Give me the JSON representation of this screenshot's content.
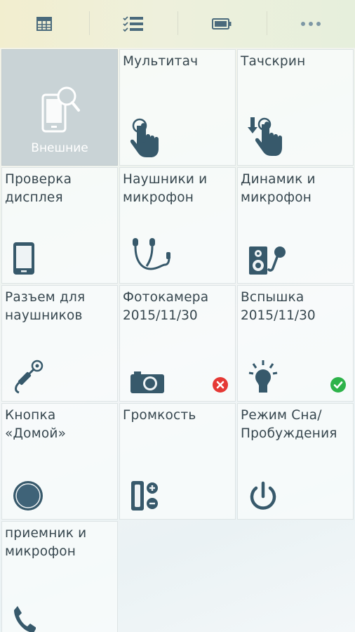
{
  "toolbar": {
    "tabs": [
      {
        "icon": "table-icon"
      },
      {
        "icon": "checklist-icon"
      },
      {
        "icon": "battery-icon"
      },
      {
        "icon": "more-icon"
      }
    ]
  },
  "colors": {
    "icon": "#37596b",
    "text": "#37474f",
    "error": "#e53935",
    "success": "#2eb34a",
    "active_tile": "#c9d3d6"
  },
  "tiles": [
    {
      "label": "Внешние",
      "icon": "phone-search-icon",
      "active": true
    },
    {
      "label": "Мультитач",
      "icon": "multitouch-icon"
    },
    {
      "label": "Тачскрин",
      "icon": "touchscreen-icon"
    },
    {
      "label": "Проверка дисплея",
      "icon": "display-icon"
    },
    {
      "label": "Наушники и микрофон",
      "icon": "headset-icon"
    },
    {
      "label": "Динамик и микрофон",
      "icon": "speaker-mic-icon"
    },
    {
      "label": "Разъем для наушников",
      "icon": "headphone-jack-icon"
    },
    {
      "label": "Фотокамера",
      "date": "2015/11/30",
      "icon": "camera-icon",
      "status": "failed"
    },
    {
      "label": "Вспышка",
      "date": "2015/11/30",
      "icon": "flash-icon",
      "status": "passed"
    },
    {
      "label": "Кнопка «Домой»",
      "icon": "home-button-icon"
    },
    {
      "label": "Громкость",
      "icon": "volume-icon"
    },
    {
      "label": "Режим Сна/ Пробуждения",
      "icon": "power-icon"
    },
    {
      "label": "приемник и микрофон",
      "icon": "phone-icon"
    }
  ]
}
